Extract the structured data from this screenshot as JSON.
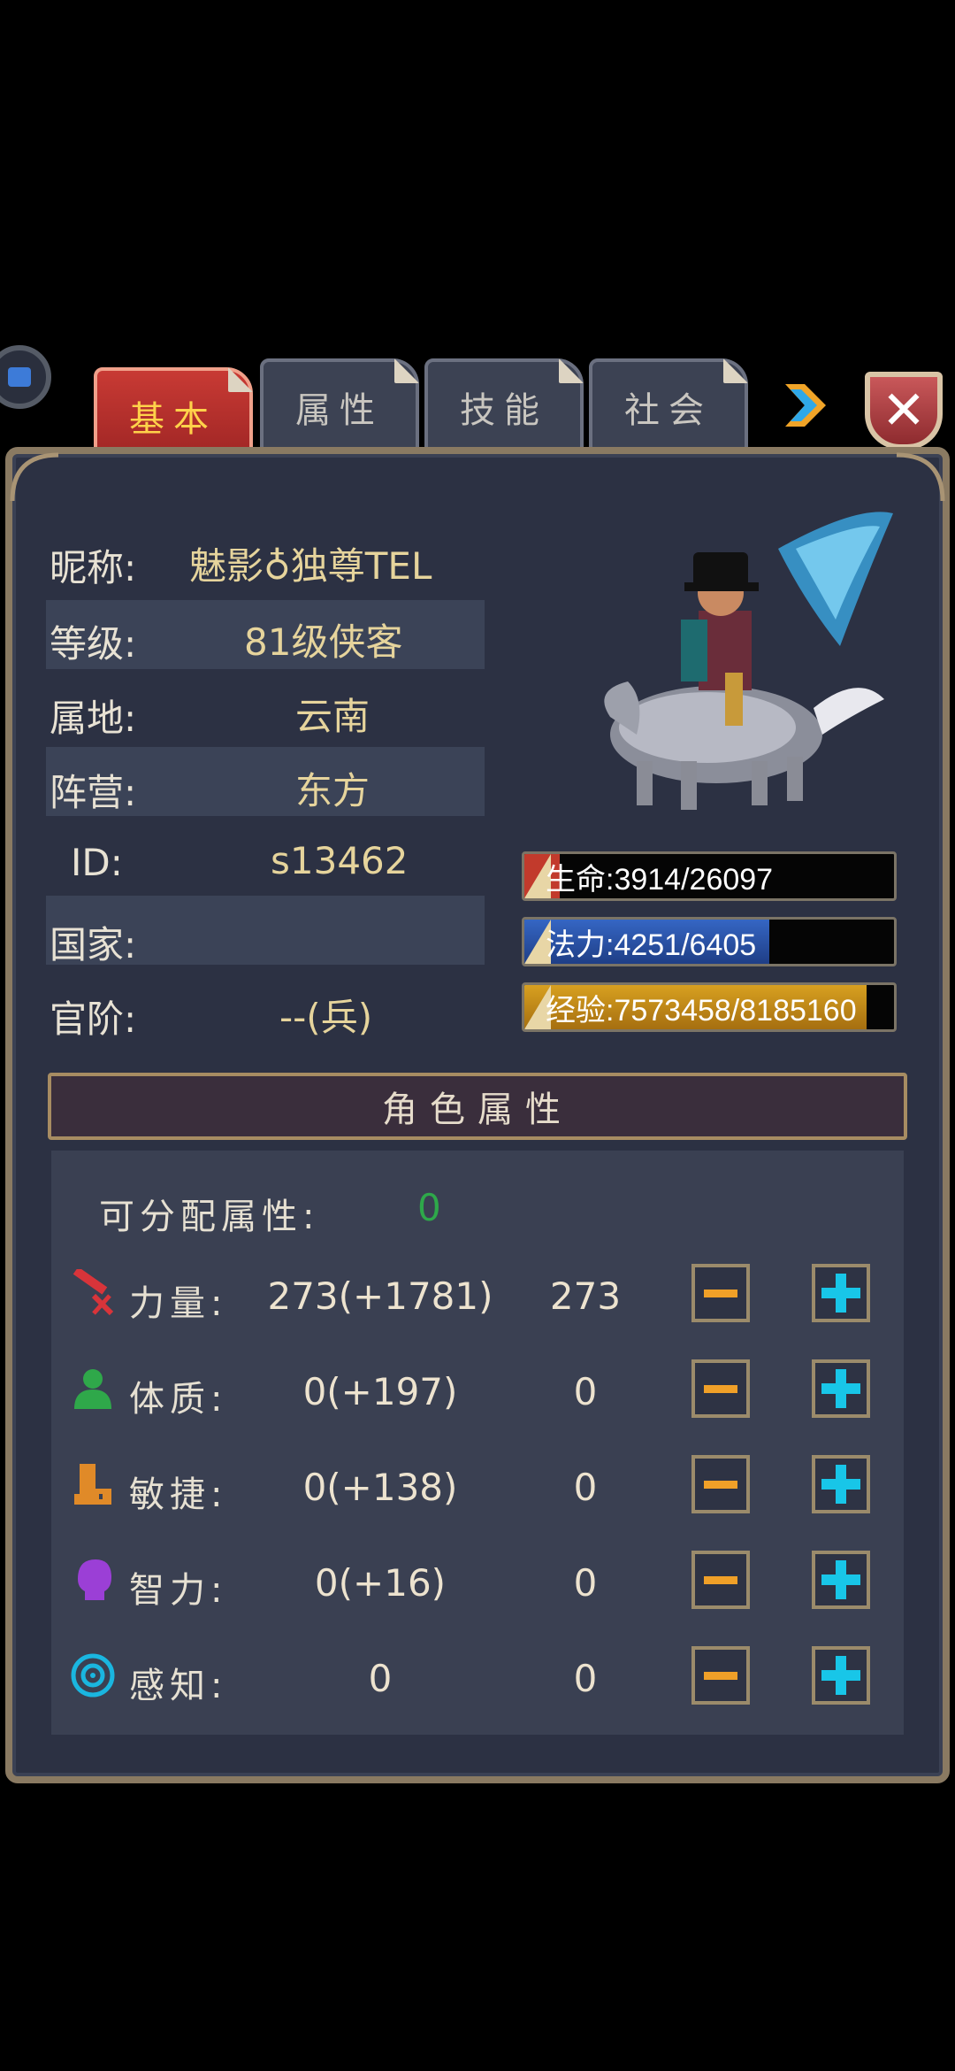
{
  "tabs": [
    {
      "label": "基本",
      "active": true
    },
    {
      "label": "属性",
      "active": false
    },
    {
      "label": "技能",
      "active": false
    },
    {
      "label": "社会",
      "active": false
    }
  ],
  "profile": {
    "nickname_label": "昵称:",
    "nickname_value": "魅影♁独尊TEL",
    "level_label": "等级:",
    "level_value": "81级侠客",
    "region_label": "属地:",
    "region_value": "云南",
    "faction_label": "阵营:",
    "faction_value": "东方",
    "id_label": "ID:",
    "id_value": "s13462",
    "country_label": "国家:",
    "country_value": "",
    "rank_label": "官阶:",
    "rank_value": "--(兵)"
  },
  "bars": {
    "hp": {
      "text": "生命:3914/26097",
      "current": 3914,
      "max": 26097,
      "color": "#c23a2c"
    },
    "mp": {
      "text": "法力:4251/6405",
      "current": 4251,
      "max": 6405,
      "color": "#3566c4"
    },
    "exp": {
      "text": "经验:7573458/8185160",
      "current": 7573458,
      "max": 8185160,
      "color": "#d8a020"
    }
  },
  "attributes": {
    "section_title": "角色属性",
    "free_points_label": "可分配属性:",
    "free_points_value": "0",
    "stats": [
      {
        "label": "力量:",
        "value": "273(+1781)",
        "alloc": "273",
        "icon": "sword-icon",
        "color": "#d8343a"
      },
      {
        "label": "体质:",
        "value": "0(+197)",
        "alloc": "0",
        "icon": "person-icon",
        "color": "#2fa84a"
      },
      {
        "label": "敏捷:",
        "value": "0(+138)",
        "alloc": "0",
        "icon": "boot-icon",
        "color": "#e08a28"
      },
      {
        "label": "智力:",
        "value": "0(+16)",
        "alloc": "0",
        "icon": "head-icon",
        "color": "#9b3fd6"
      },
      {
        "label": "感知:",
        "value": "0",
        "alloc": "0",
        "icon": "target-icon",
        "color": "#1ab6e0"
      }
    ]
  },
  "colors": {
    "panel_bg": "#2c3143",
    "accent_gold": "#e6d49c",
    "free_points_green": "#2ea84a"
  }
}
